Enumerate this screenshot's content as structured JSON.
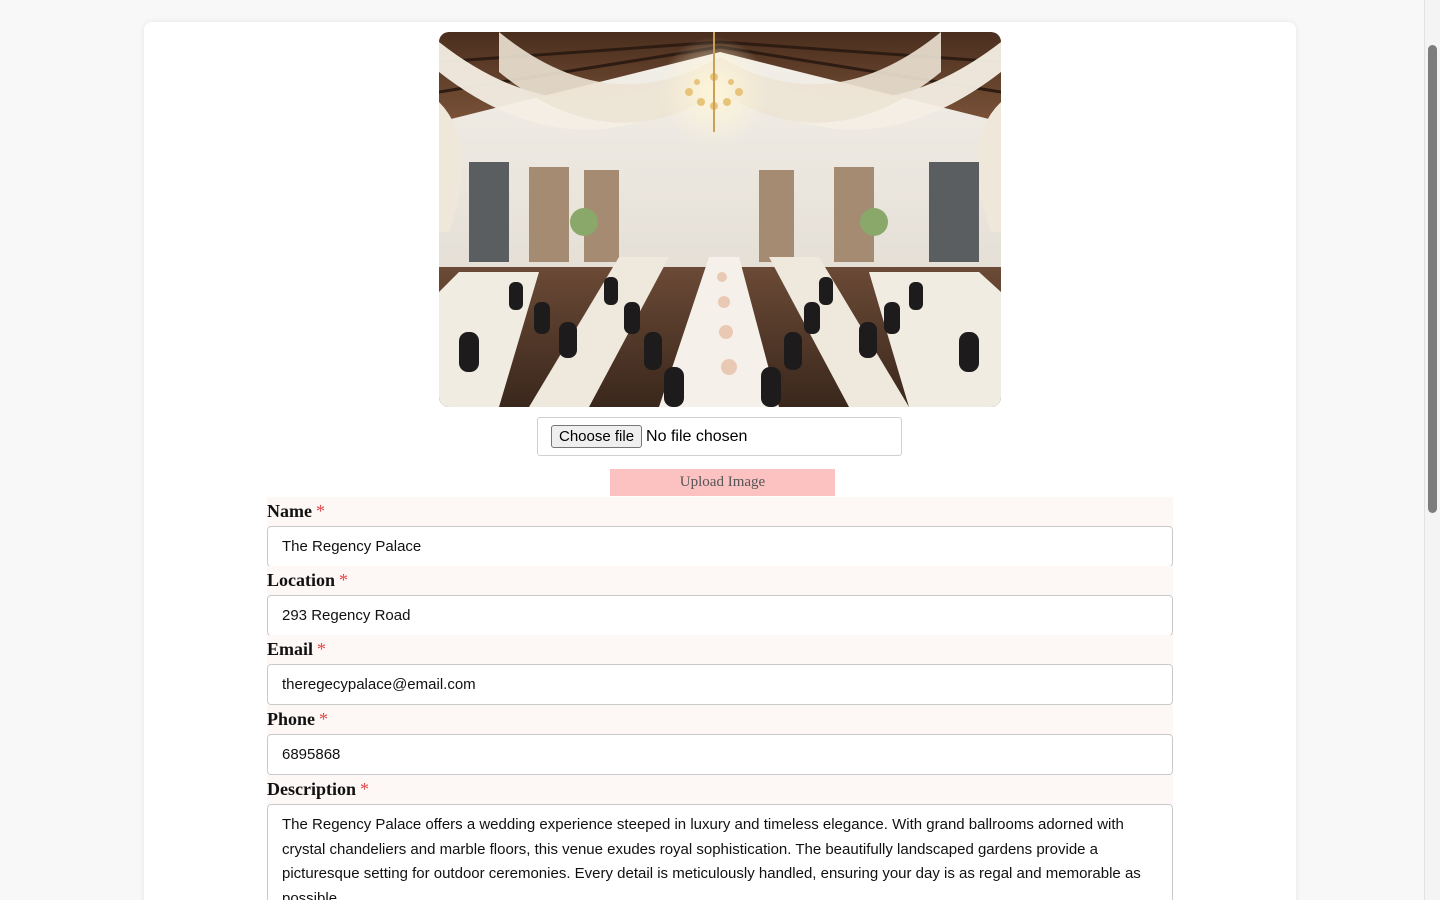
{
  "image_section": {
    "choose_file_label": "Choose file",
    "file_status": "No file chosen",
    "upload_button_label": "Upload Image"
  },
  "form": {
    "required_marker": "*",
    "name": {
      "label": "Name",
      "value": "The Regency Palace"
    },
    "location": {
      "label": "Location",
      "value": "293 Regency Road"
    },
    "email": {
      "label": "Email",
      "value": "theregecypalace@email.com"
    },
    "phone": {
      "label": "Phone",
      "value": "6895868"
    },
    "description": {
      "label": "Description",
      "value": "The Regency Palace offers a wedding experience steeped in luxury and timeless elegance. With grand ballrooms adorned with crystal chandeliers and marble floors, this venue exudes royal sophistication. The beautifully landscaped gardens provide a picturesque setting for outdoor ceremonies. Every detail is meticulously handled, ensuring your day is as regal and memorable as possible"
    }
  },
  "colors": {
    "upload_button_bg": "#fcc2c2",
    "required_marker": "#e04848",
    "label_bg": "#fdf7f6"
  }
}
